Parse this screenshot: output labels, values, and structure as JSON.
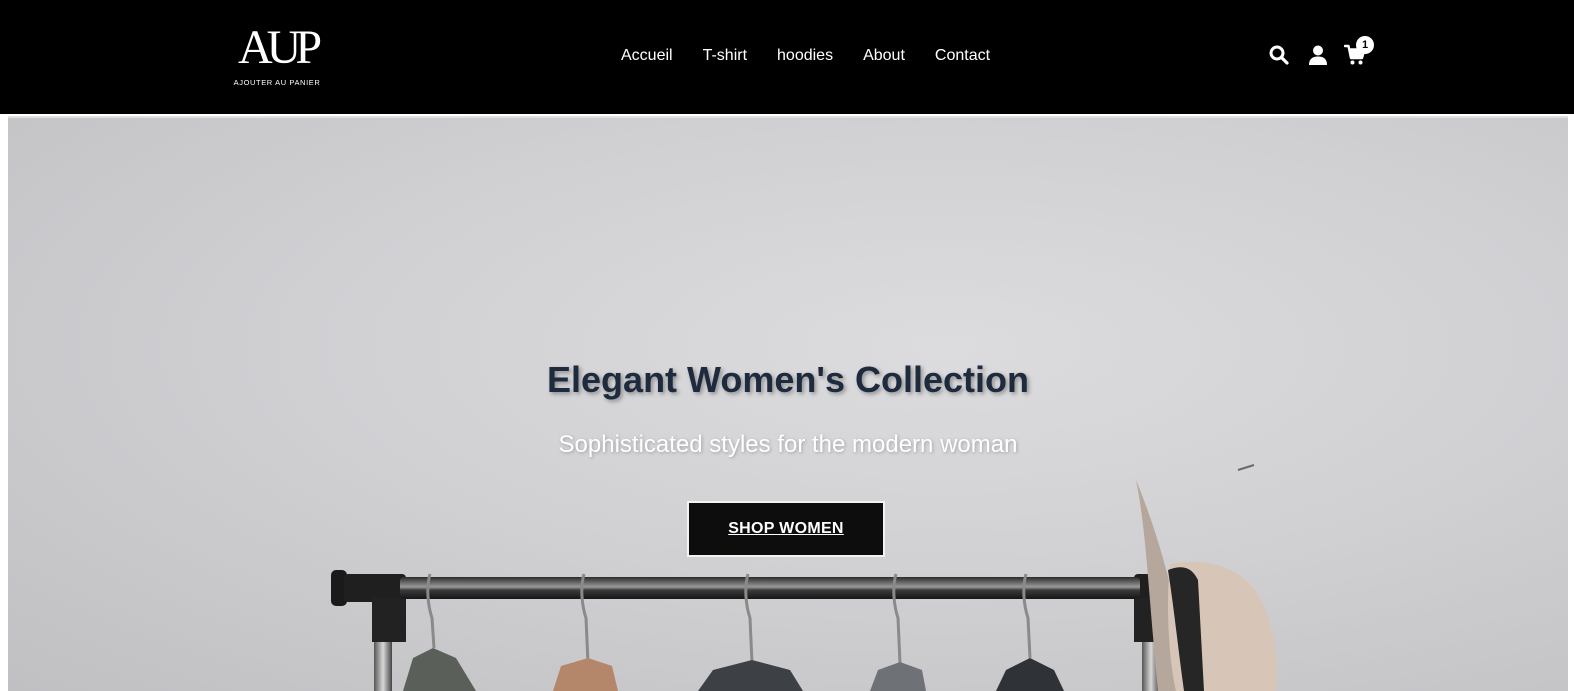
{
  "brand": {
    "logo_mark": "AUP",
    "logo_subtitle": "AJOUTER AU PANIER"
  },
  "nav": {
    "items": [
      {
        "label": "Accueil"
      },
      {
        "label": "T-shirt"
      },
      {
        "label": "hoodies"
      },
      {
        "label": "About"
      },
      {
        "label": "Contact"
      }
    ]
  },
  "header_icons": {
    "search": "search-icon",
    "account": "user-icon",
    "cart": "cart-icon",
    "cart_count": "1"
  },
  "hero": {
    "title": "Elegant Women's Collection",
    "subtitle": "Sophisticated styles for the modern woman",
    "cta_label": "SHOP WOMEN"
  },
  "colors": {
    "header_bg": "#000000",
    "hero_title": "#1e2a3d",
    "button_bg": "#0d0d0d"
  }
}
